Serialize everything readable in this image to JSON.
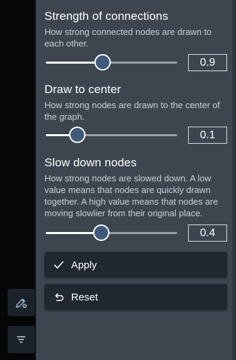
{
  "sections": [
    {
      "title": "Strength of connections",
      "description": "How strong connected nodes are drawn to each other.",
      "value": "0.9",
      "slider_fraction": 0.43
    },
    {
      "title": "Draw to center",
      "description": "How strong nodes are drawn to the center of the graph.",
      "value": "0.1",
      "slider_fraction": 0.24
    },
    {
      "title": "Slow down nodes",
      "description": "How strong nodes are slowed down. A low value means that nodes are quickly drawn together. A high value means that nodes are moving slowlier from their original place.",
      "value": "0.4",
      "slider_fraction": 0.42
    }
  ],
  "actions": {
    "apply_label": "Apply",
    "reset_label": "Reset"
  },
  "rail": {
    "edit_icon": "edit-settings-icon",
    "filter_icon": "filter-icon"
  }
}
